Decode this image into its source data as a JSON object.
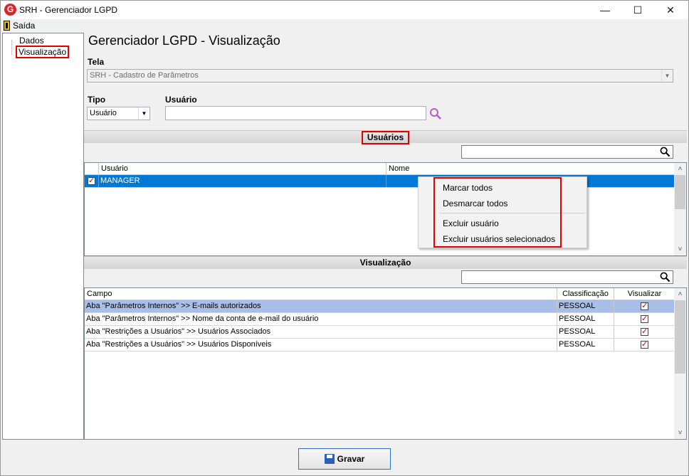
{
  "window": {
    "title": "SRH - Gerenciador LGPD",
    "app_icon_glyph": "G",
    "minimize_glyph": "—",
    "maximize_glyph": "☐",
    "close_glyph": "✕"
  },
  "menu": {
    "exit_label": "Saída"
  },
  "tree": {
    "items": [
      {
        "label": "Dados"
      },
      {
        "label": "Visualização"
      }
    ]
  },
  "main": {
    "title": "Gerenciador LGPD - Visualização",
    "tela_label": "Tela",
    "tela_value": "SRH - Cadastro de Parâmetros",
    "tipo_label": "Tipo",
    "tipo_value": "Usuário",
    "usuario_label": "Usuário",
    "usuario_value": ""
  },
  "usuarios_section": {
    "title": "Usuários",
    "search_value": "",
    "columns": [
      "Usuário",
      "Nome"
    ],
    "rows": [
      {
        "checked": true,
        "usuario": "MANAGER",
        "nome": ""
      }
    ]
  },
  "context_menu": {
    "items": [
      "Marcar todos",
      "Desmarcar todos",
      "Excluir usuário",
      "Excluir usuários selecionados"
    ]
  },
  "visualizacao_section": {
    "title": "Visualização",
    "search_value": "",
    "columns": [
      "Campo",
      "Classificação",
      "Visualizar"
    ],
    "rows": [
      {
        "campo": "Aba \"Parâmetros Internos\" >> E-mails autorizados",
        "classificacao": "PESSOAL",
        "visualizar": true
      },
      {
        "campo": "Aba \"Parâmetros Internos\" >> Nome da conta de e-mail do usuário",
        "classificacao": "PESSOAL",
        "visualizar": true
      },
      {
        "campo": "Aba \"Restrições a Usuários\" >> Usuários Associados",
        "classificacao": "PESSOAL",
        "visualizar": true
      },
      {
        "campo": "Aba \"Restrições a Usuários\" >> Usuários Disponíveis",
        "classificacao": "PESSOAL",
        "visualizar": true
      }
    ]
  },
  "footer": {
    "save_label": "Gravar"
  },
  "colors": {
    "selected_row": "#0078d7",
    "highlight_row": "#a9bee6",
    "annotation": "#e00000",
    "accent_border": "#2a72c9"
  }
}
